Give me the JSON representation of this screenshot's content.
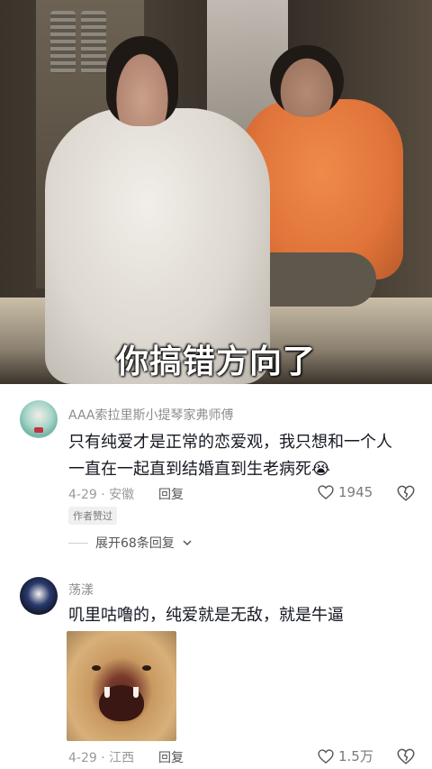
{
  "video": {
    "subtitle": "你搞错方向了"
  },
  "comments": [
    {
      "username": "AAA索拉里斯小提琴家弗师傅",
      "text": "只有纯爱才是正常的恋爱观，我只想和一个人一直在一起直到结婚直到生老病死😭",
      "meta": "4-29 · 安徽",
      "reply_label": "回复",
      "likes": "1945",
      "badge": "作者赞过",
      "expand_label": "展开68条回复"
    },
    {
      "username": "荡漾",
      "text": "叽里咕噜的，纯爱就是无敌，就是牛逼",
      "meta": "4-29 · 江西",
      "reply_label": "回复",
      "likes": "1.5万"
    }
  ],
  "icons": {
    "like": "heart-outline-icon",
    "dislike": "broken-heart-icon",
    "expand": "chevron-down-icon"
  },
  "colors": {
    "username": "#8d8d8d",
    "text": "#161823",
    "meta": "#9a9a9a"
  }
}
